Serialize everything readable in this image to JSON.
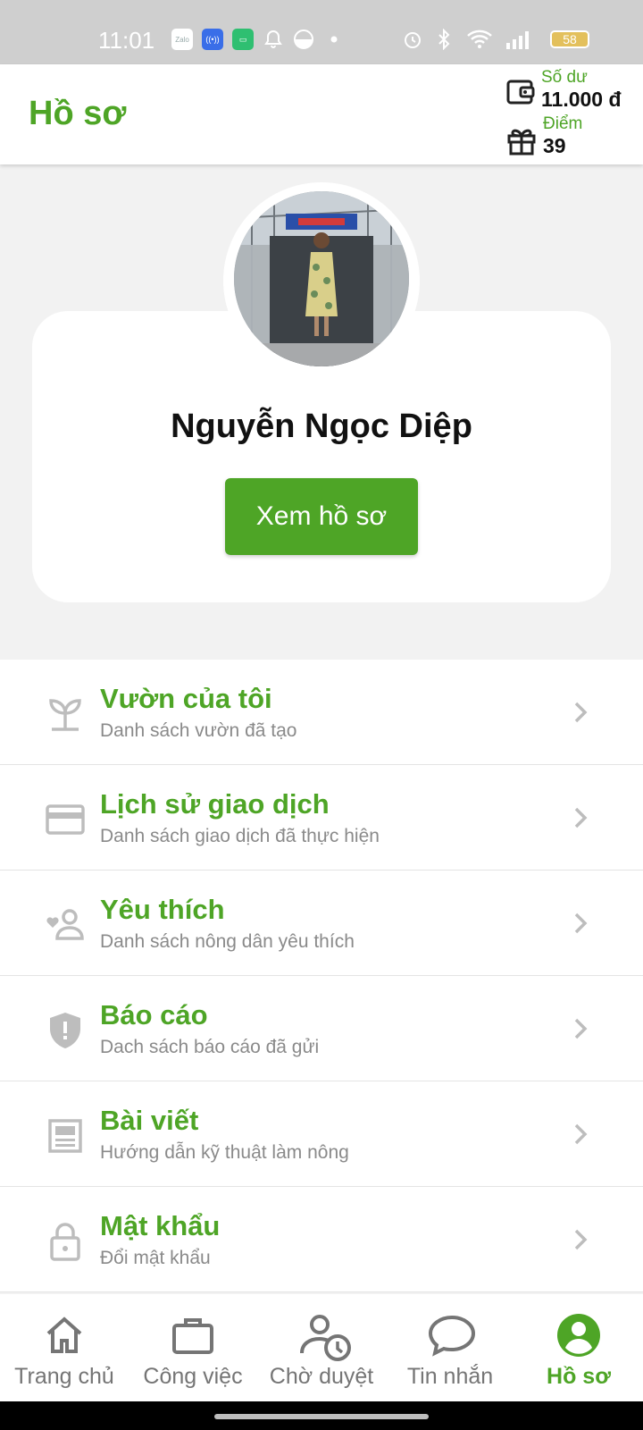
{
  "status_bar": {
    "time": "11:01",
    "battery": "58",
    "left_icons": [
      "zalo-icon",
      "radio-icon",
      "chat-icon",
      "bell-icon",
      "moon-icon",
      "dot-icon"
    ],
    "right_icons": [
      "alarm-icon",
      "bluetooth-icon",
      "wifi-icon",
      "signal-icon",
      "battery-icon"
    ]
  },
  "header": {
    "title": "Hồ sơ",
    "balance_label": "Số dư",
    "balance_value": "11.000 đ",
    "points_label": "Điểm",
    "points_value": "39"
  },
  "profile": {
    "name": "Nguyễn Ngọc Diệp",
    "view_button": "Xem hồ sơ"
  },
  "menu": [
    {
      "icon": "plant-icon",
      "title": "Vườn của tôi",
      "subtitle": "Danh sách vườn đã tạo"
    },
    {
      "icon": "credit-card-icon",
      "title": "Lịch sử giao dịch",
      "subtitle": "Danh sách giao dịch đã thực hiện"
    },
    {
      "icon": "favorite-person-icon",
      "title": "Yêu thích",
      "subtitle": "Danh sách nông dân yêu thích"
    },
    {
      "icon": "shield-alert-icon",
      "title": "Báo cáo",
      "subtitle": "Dach sách báo cáo đã gửi"
    },
    {
      "icon": "article-icon",
      "title": "Bài viết",
      "subtitle": "Hướng dẫn kỹ thuật làm nông"
    },
    {
      "icon": "lock-icon",
      "title": "Mật khẩu",
      "subtitle": "Đổi mật khẩu"
    }
  ],
  "bottom_nav": [
    {
      "icon": "home-icon",
      "label": "Trang chủ",
      "active": false
    },
    {
      "icon": "briefcase-icon",
      "label": "Công việc",
      "active": false
    },
    {
      "icon": "pending-person-icon",
      "label": "Chờ duyệt",
      "active": false
    },
    {
      "icon": "chat-bubble-icon",
      "label": "Tin nhắn",
      "active": false
    },
    {
      "icon": "account-circle-icon",
      "label": "Hồ sơ",
      "active": true
    }
  ],
  "colors": {
    "accent": "#4ea526",
    "icon_gray": "#bdbdbd",
    "nav_gray": "#757575",
    "status_bar": "#cfcfcf"
  }
}
